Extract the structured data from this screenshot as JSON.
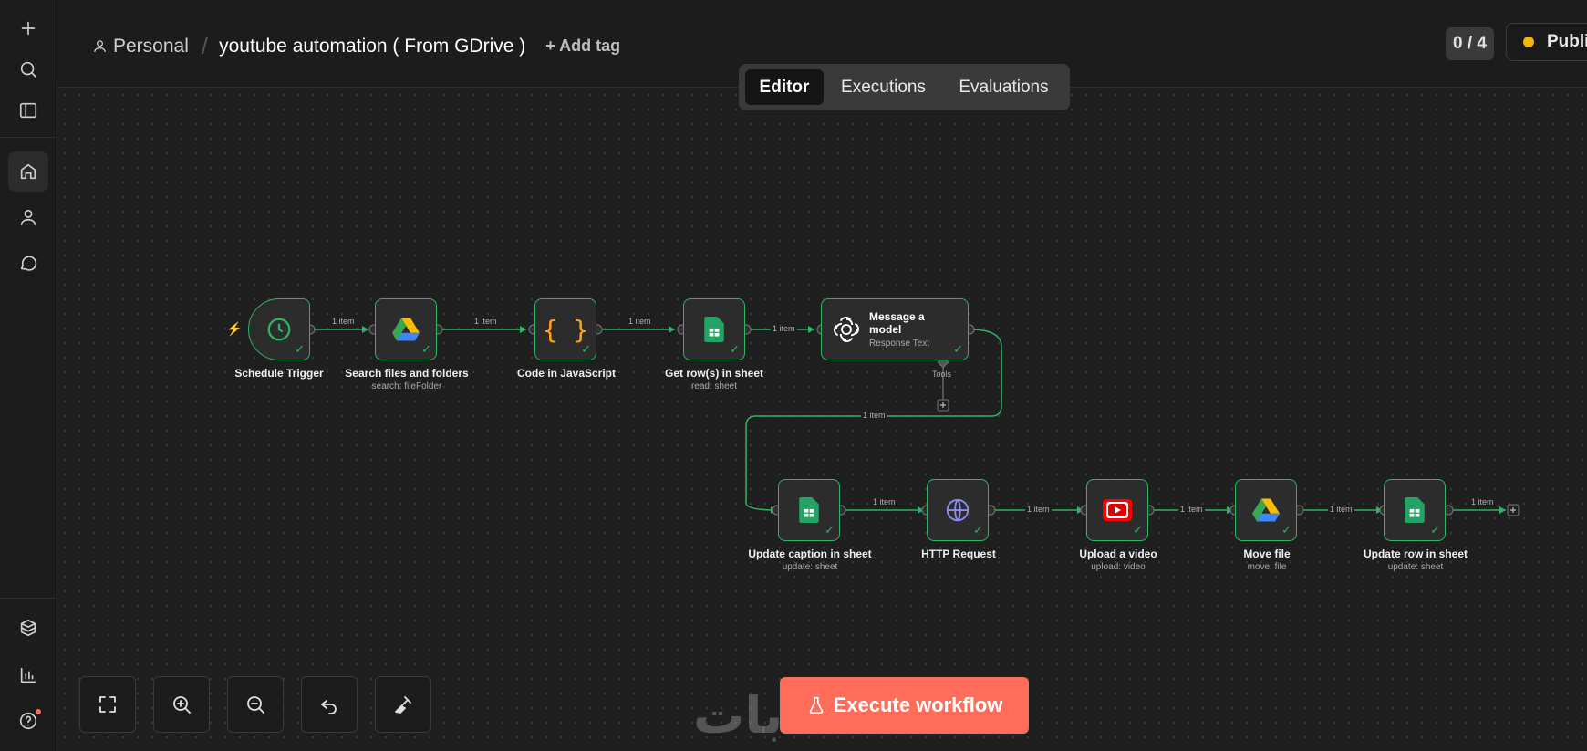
{
  "header": {
    "project": "Personal",
    "separator": "/",
    "workflow_name": "youtube automation ( From GDrive )",
    "add_tag": "+ Add tag",
    "counter": "0 / 4",
    "publish": "Publis"
  },
  "tabs": [
    {
      "label": "Editor",
      "active": true
    },
    {
      "label": "Executions",
      "active": false
    },
    {
      "label": "Evaluations",
      "active": false
    }
  ],
  "nodes": {
    "schedule": {
      "title": "Schedule Trigger",
      "subtitle": ""
    },
    "search": {
      "title": "Search files and folders",
      "subtitle": "search: fileFolder"
    },
    "code": {
      "title": "Code in JavaScript",
      "subtitle": ""
    },
    "getrows": {
      "title": "Get row(s) in sheet",
      "subtitle": "read: sheet"
    },
    "message": {
      "title": "Message a model",
      "subtitle": "Response Text",
      "tools": "Tools"
    },
    "updatecaption": {
      "title": "Update caption in sheet",
      "subtitle": "update: sheet"
    },
    "http": {
      "title": "HTTP Request",
      "subtitle": ""
    },
    "upload": {
      "title": "Upload a video",
      "subtitle": "upload: video"
    },
    "move": {
      "title": "Move file",
      "subtitle": "move: file"
    },
    "updaterow": {
      "title": "Update row in sheet",
      "subtitle": "update: sheet"
    }
  },
  "edge_label": "1 item",
  "code_glyph": "{ }",
  "execute_button": "Execute workflow",
  "watermark": "حسابات",
  "colors": {
    "accent": "#ff6d5a",
    "success": "#2fb463",
    "publish_dot": "#f5b400",
    "code": "#ff9f1c"
  }
}
